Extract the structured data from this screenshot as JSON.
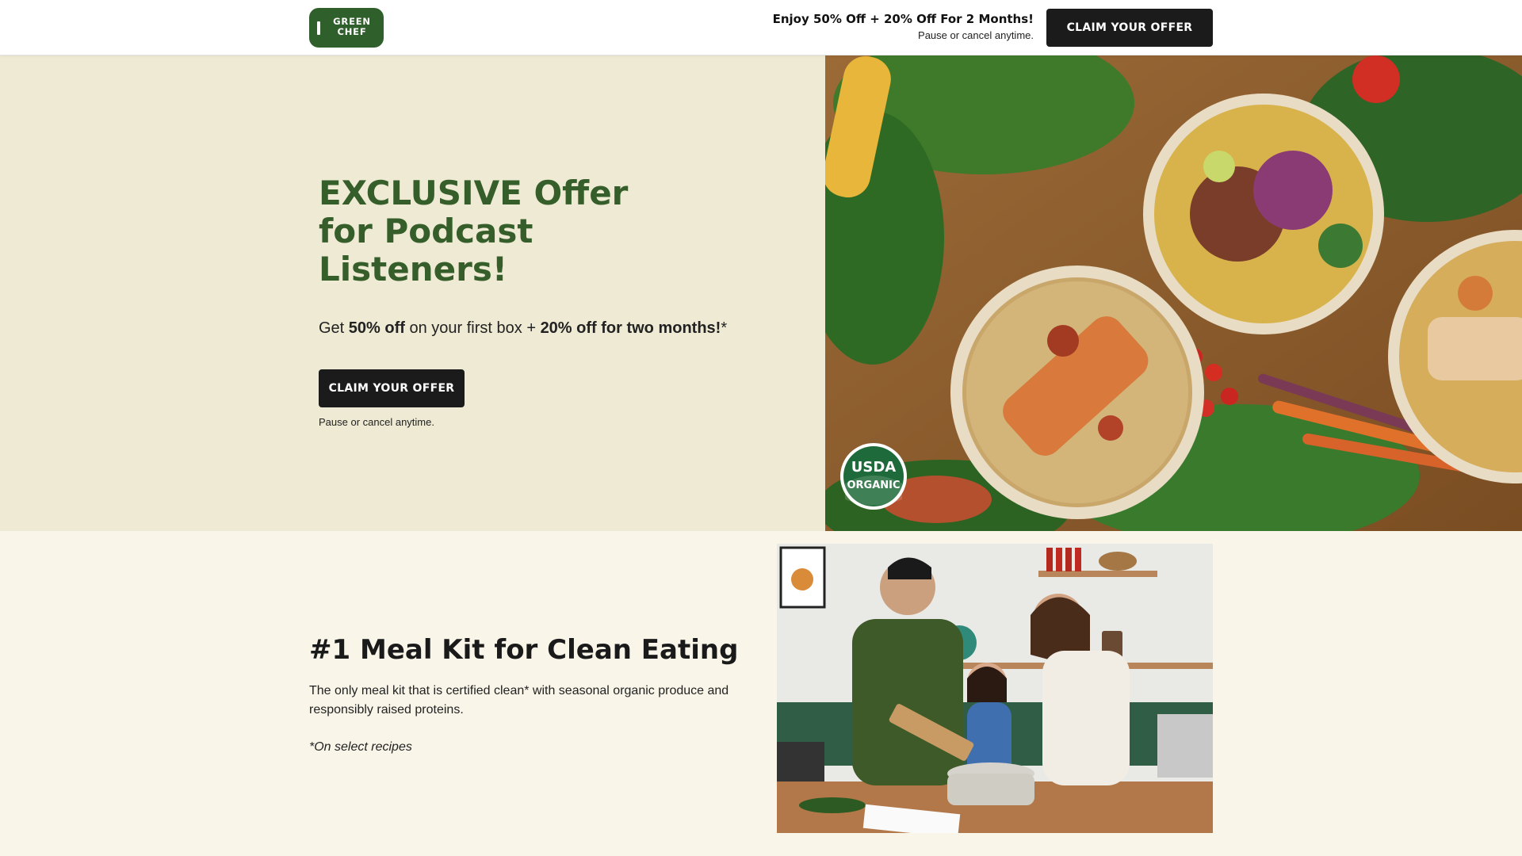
{
  "header": {
    "logo_line1": "GREEN",
    "logo_line2": "CHEF",
    "offer_title": "Enjoy 50% Off + 20% Off For 2 Months!",
    "offer_sub": "Pause or cancel anytime.",
    "cta_label": "CLAIM YOUR OFFER"
  },
  "hero": {
    "title": "EXCLUSIVE Offer for Podcast Listeners!",
    "sub_prefix": "Get ",
    "sub_bold1": "50% off",
    "sub_mid": " on your first box + ",
    "sub_bold2": "20% off for two months!",
    "sub_suffix": "*",
    "cta_label": "CLAIM YOUR OFFER",
    "note": "Pause or cancel anytime.",
    "badge_line1": "USDA",
    "badge_line2": "ORGANIC"
  },
  "section2": {
    "title": "#1 Meal Kit for Clean Eating",
    "body": "The only meal kit that is certified clean* with seasonal organic produce and responsibly raised proteins.",
    "note": "*On select recipes"
  },
  "colors": {
    "brand_green": "#2f5f2a",
    "headline_green": "#355e2b",
    "hero_bg": "#eeead3",
    "section_bg": "#f9f6e9",
    "cta_bg": "#1b1b1b"
  }
}
